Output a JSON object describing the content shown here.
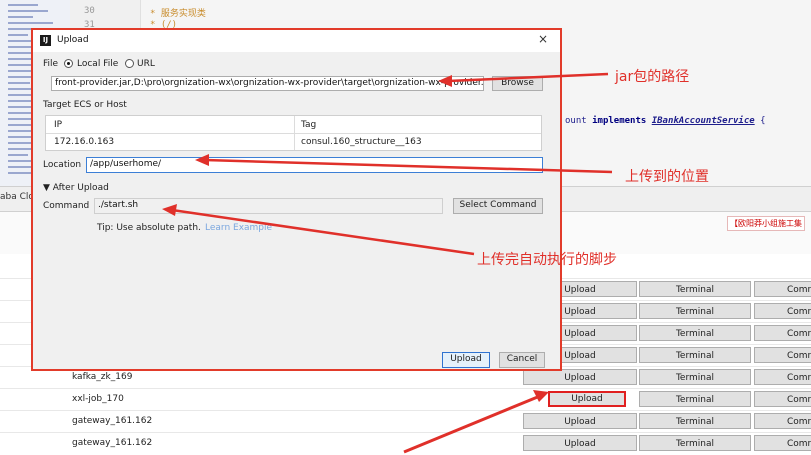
{
  "ide": {
    "line_numbers": [
      "30",
      "31"
    ],
    "comments": [
      "*  服务实现类",
      "* (/)"
    ],
    "code": {
      "frag": "ount",
      "implements": "implements",
      "iface": "IBankAccountService",
      "brace": "{"
    },
    "aliyun_tab": "aba Clo",
    "red_note": "【欧阳莽小组施工集"
  },
  "hosts": {
    "rows": [
      {
        "name": ""
      },
      {
        "name": ""
      },
      {
        "name": ""
      },
      {
        "name": ""
      },
      {
        "name": "kafka_zk_169"
      },
      {
        "name": "xxl-job_170"
      },
      {
        "name": "gateway_161.162"
      },
      {
        "name": "gateway_161.162"
      }
    ],
    "upload_label": "Upload",
    "terminal_label": "Terminal",
    "command_label": "Comr"
  },
  "dialog": {
    "title": "Upload",
    "close_glyph": "×",
    "file_label": "File",
    "local_file_label": "Local File",
    "url_label": "URL",
    "file_path": "front-provider.jar,D:\\pro\\orgnization-wx\\orgnization-wx-provider\\target\\orgnization-wx-provider.jar",
    "browse_label": "Browse",
    "target_label": "Target ECS or Host",
    "table": {
      "headers": [
        "IP",
        "Tag"
      ],
      "row": [
        "172.16.0.163",
        "consul.160_structure__163"
      ]
    },
    "location_label": "Location",
    "location_value": "/app/userhome/",
    "after_upload_label": "▼ After Upload",
    "command_label": "Command",
    "command_value": "./start.sh",
    "select_command_label": "Select Command",
    "tip_text": "Tip: Use absolute path.",
    "learn_example": "Learn Example",
    "upload_button": "Upload",
    "cancel_button": "Cancel"
  },
  "annotations": {
    "jar_path": "jar包的路径",
    "upload_location": "上传到的位置",
    "auto_script": "上传完自动执行的脚步"
  },
  "colors": {
    "annotation_red": "#e0302a",
    "focus_blue": "#3c7fd6"
  }
}
